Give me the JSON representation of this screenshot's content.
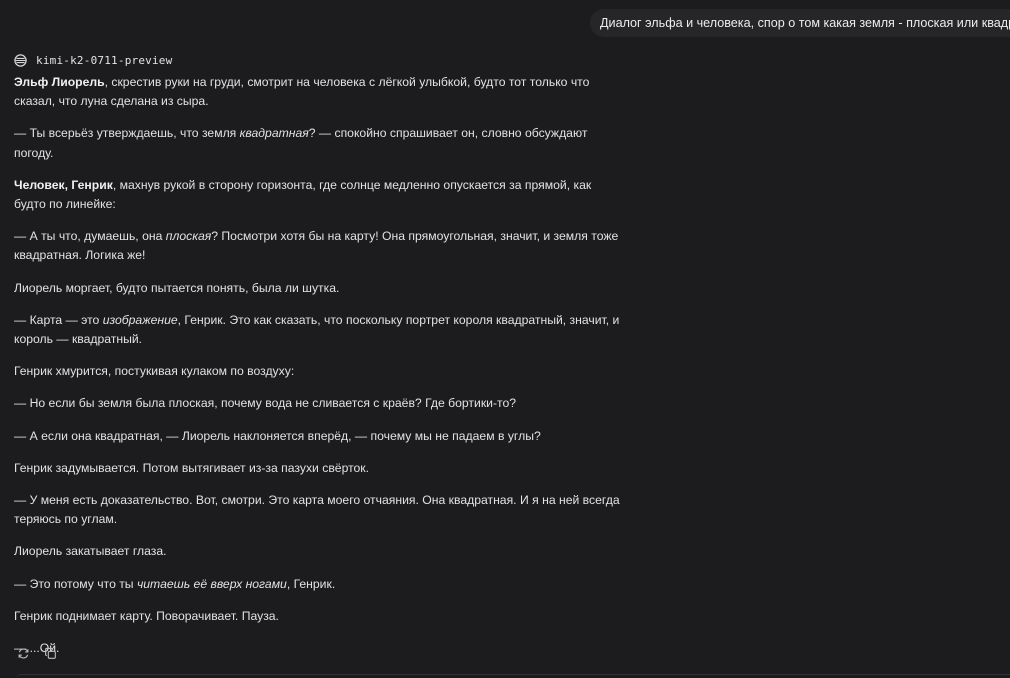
{
  "user_message": {
    "text": "Диалог эльфа и человека, спор о том какая земля - плоская или квадратная"
  },
  "model": {
    "name": "kimi-k2-0711-preview",
    "icon": "kimi-logo-icon"
  },
  "response": {
    "p1": {
      "bold": "Эльф Лиорель",
      "rest": ", скрестив руки на груди, смотрит на человека с лёгкой улыбкой, будто тот только что сказал, что луна сделана из сыра."
    },
    "p2": {
      "before": "— Ты всерьёз утверждаешь, что земля ",
      "italic": "квадратная",
      "after": "? — спокойно спрашивает он, словно обсуждают погоду."
    },
    "p3": {
      "bold": "Человек, Генрик",
      "rest": ", махнув рукой в сторону горизонта, где солнце медленно опускается за прямой, как будто по линейке:"
    },
    "p4": {
      "before": "— А ты что, думаешь, она ",
      "italic": "плоская",
      "after": "? Посмотри хотя бы на карту! Она прямоугольная, значит, и земля тоже квадратная. Логика же!"
    },
    "p5": "Лиорель моргает, будто пытается понять, была ли шутка.",
    "p6": {
      "before": "— Карта — это ",
      "italic": "изображение",
      "after": ", Генрик. Это как сказать, что поскольку портрет короля квадратный, значит, и король — квадратный."
    },
    "p7": "Генрик хмурится, постукивая кулаком по воздуху:",
    "p8": "— Но если бы земля была плоская, почему вода не сливается с краёв? Где бортики-то?",
    "p9": "— А если она квадратная, — Лиорель наклоняется вперёд, — почему мы не падаем в углы?",
    "p10": "Генрик задумывается. Потом вытягивает из-за пазухи свёрток.",
    "p11": "— У меня есть доказательство. Вот, смотри. Это карта моего отчаяния. Она квадратная. И я на ней всегда теряюсь по углам.",
    "p12": "Лиорель закатывает глаза.",
    "p13": {
      "before": "— Это потому что ты ",
      "italic": "читаешь её вверх ногами",
      "after": ", Генрик."
    },
    "p14": "Генрик поднимает карту. Поворачивает. Пауза.",
    "p15": "— ...Ой."
  },
  "actions": {
    "regenerate_icon": "refresh-icon",
    "copy_icon": "copy-icon"
  }
}
